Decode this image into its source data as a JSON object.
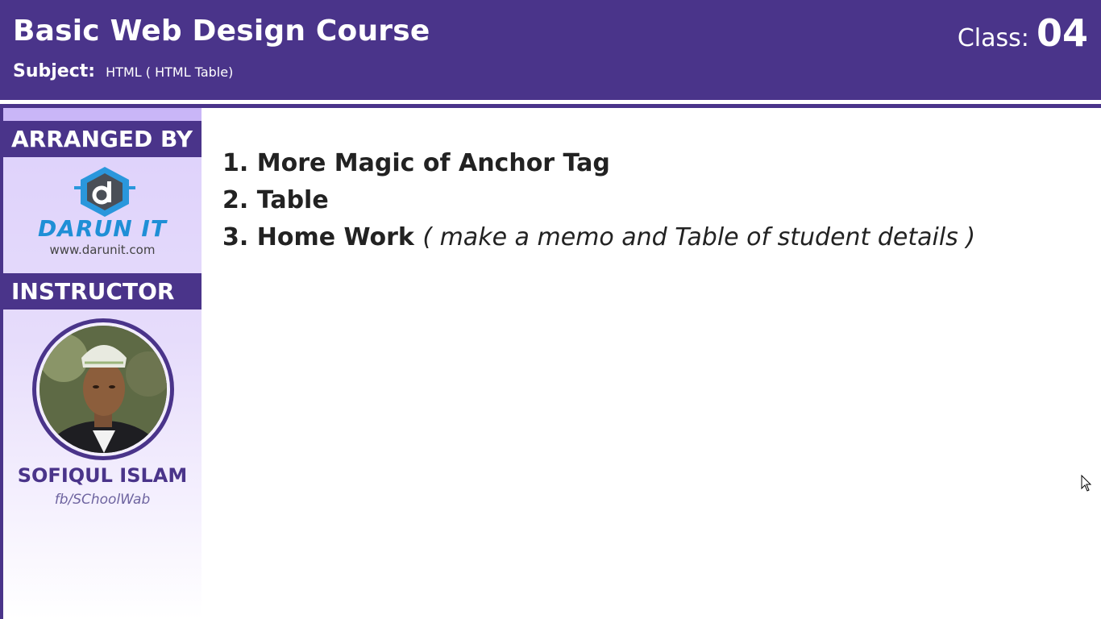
{
  "header": {
    "course_title": "Basic Web Design Course",
    "subject_label": "Subject:",
    "subject_value": "HTML ( HTML Table)",
    "class_label": "Class:",
    "class_number": "04"
  },
  "sidebar": {
    "arranged_by_heading": "ARRANGED BY",
    "logo_name": "DARUN IT",
    "logo_url": "www.darunit.com",
    "instructor_heading": "INSTRUCTOR",
    "instructor_name": "SOFIQUL ISLAM",
    "instructor_fb": "fb/SChoolWab"
  },
  "topics": [
    {
      "number": "1.",
      "title": "More Magic of Anchor Tag",
      "note": ""
    },
    {
      "number": "2.",
      "title": "Table",
      "note": ""
    },
    {
      "number": "3.",
      "title": "Home Work",
      "note": "( make a memo and Table of student details )"
    }
  ],
  "colors": {
    "brand_purple": "#4a348a",
    "sidebar_lavender": "#ddd0fb",
    "logo_blue": "#1f8fd6"
  },
  "icons": {
    "logo": "darun-it-logo-icon",
    "cursor": "mouse-pointer-icon"
  }
}
